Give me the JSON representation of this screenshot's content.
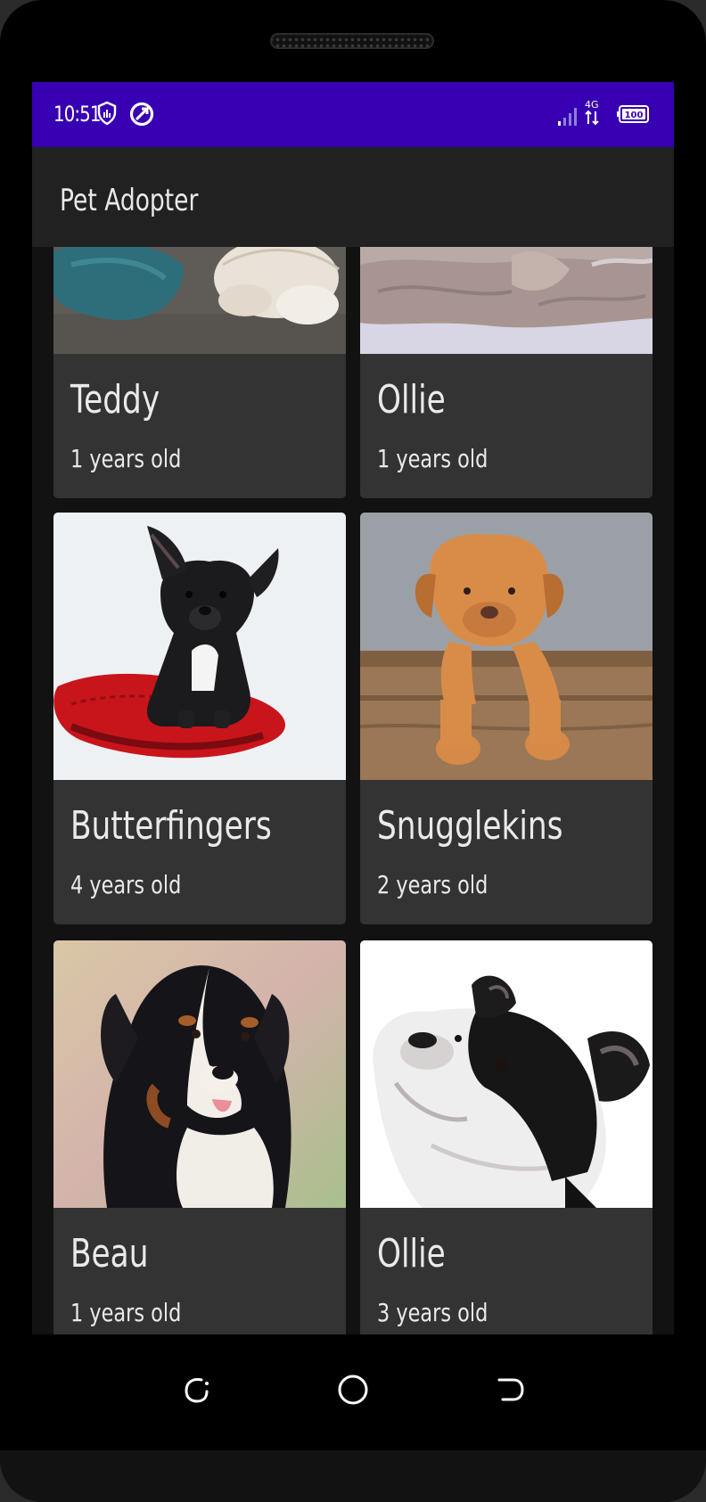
{
  "status_bar": {
    "time": "10:51",
    "network": "4G",
    "battery": "100",
    "color": "#3700b3"
  },
  "app_bar": {
    "title": "Pet Adopter"
  },
  "pets": [
    {
      "name": "Teddy",
      "age": "1 years old",
      "photo": "white-puppy-on-sofa"
    },
    {
      "name": "Ollie",
      "age": "1 years old",
      "photo": "dog-on-blanket"
    },
    {
      "name": "Butterfingers",
      "age": "4 years old",
      "photo": "french-bulldog-on-red-pillow"
    },
    {
      "name": "Snugglekins",
      "age": "2 years old",
      "photo": "dogue-de-bordeaux-puppy"
    },
    {
      "name": "Beau",
      "age": "1 years old",
      "photo": "bernese-mountain-dog"
    },
    {
      "name": "Ollie",
      "age": "3 years old",
      "photo": "french-bulldog-looking-up"
    }
  ],
  "nav": {
    "icons": [
      "recents-icon",
      "home-icon",
      "back-icon"
    ]
  },
  "theme": {
    "card_bg": "#333333",
    "screen_bg": "#121212",
    "app_bar_bg": "#212121"
  }
}
